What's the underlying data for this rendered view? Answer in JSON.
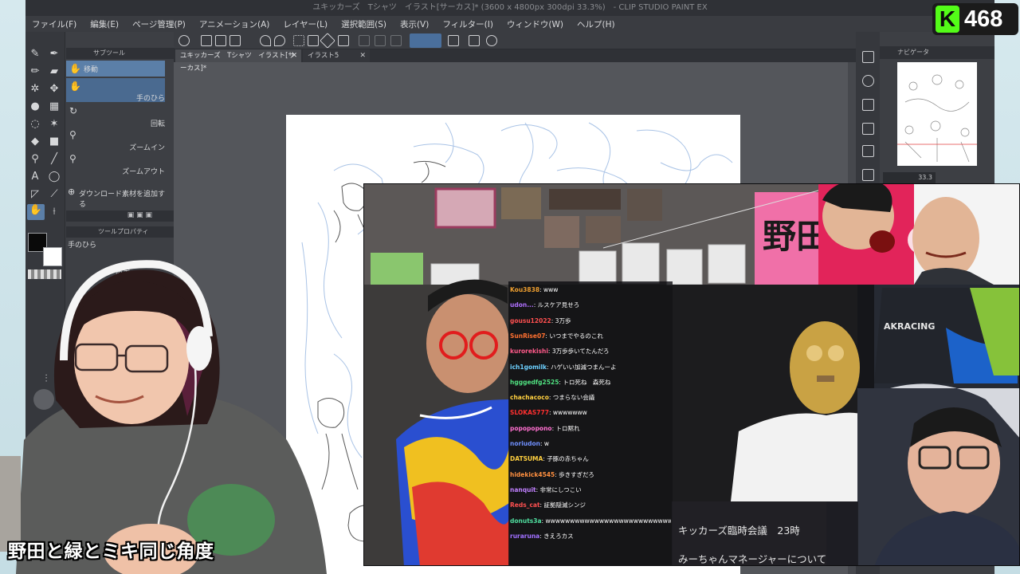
{
  "app": {
    "window_title": "ユキッカーズ　Tシャツ　イラスト[サーカス]* (3600 x 4800px 300dpi 33.3%)　- CLIP STUDIO PAINT EX",
    "menu": [
      "ファイル(F)",
      "編集(E)",
      "ページ管理(P)",
      "アニメーション(A)",
      "レイヤー(L)",
      "選択範囲(S)",
      "表示(V)",
      "フィルター(I)",
      "ウィンドウ(W)",
      "ヘルプ(H)"
    ]
  },
  "subtool": {
    "panel_title": "サブツール",
    "items": [
      {
        "label": "移動",
        "icon": "hand-icon"
      },
      {
        "label": "手のひら",
        "icon": "hand-icon"
      },
      {
        "label": "回転",
        "icon": "rotate-icon"
      },
      {
        "label": "ズームイン",
        "icon": "magnifier-icon"
      },
      {
        "label": "ズームアウト",
        "icon": "magnifier-icon"
      }
    ],
    "add_material": "ダウンロード素材を追加する"
  },
  "tool_property": {
    "panel_title": "ツールプロパティ",
    "tool_name": "手のひら",
    "setting_partial": "設定"
  },
  "documents": {
    "tabs": [
      {
        "label": "ユキッカーズ　Tシャツ　イラスト[サーカス]*"
      },
      {
        "label": "イラスト5"
      }
    ]
  },
  "navigator": {
    "panel_title": "ナビゲータ",
    "zoom": "33.3"
  },
  "chat": [
    {
      "user": "Kou3838",
      "msg": "www",
      "color": "#f0a030"
    },
    {
      "user": "udon...",
      "msg": "ルスケア見せろ",
      "color": "#b070ff"
    },
    {
      "user": "gousu12022",
      "msg": "3万歩",
      "color": "#ff5050"
    },
    {
      "user": "SunRise07",
      "msg": "いつまでやるのこれ",
      "color": "#ff7030"
    },
    {
      "user": "kurorekishi",
      "msg": "3万歩歩いてたんだろ",
      "color": "#ff5a8a"
    },
    {
      "user": "ich1gomilk",
      "msg": "ハゲいい加減つまんーよ",
      "color": "#6cd0ff"
    },
    {
      "user": "hgggedfg2525",
      "msg": "トロ死ね　森死ね",
      "color": "#50e080"
    },
    {
      "user": "chachacoco",
      "msg": "つまらない会議",
      "color": "#ffd040"
    },
    {
      "user": "SLOKAS777",
      "msg": "wwwwwww",
      "color": "#ff3030"
    },
    {
      "user": "popopopono",
      "msg": "トロ黙れ",
      "color": "#ff70d0"
    },
    {
      "user": "noriudon",
      "msg": "w",
      "color": "#7090ff"
    },
    {
      "user": "DATSUMA",
      "msg": "子豚の赤ちゃん",
      "color": "#ffd040"
    },
    {
      "user": "hidekick4545",
      "msg": "歩きすぎだろ",
      "color": "#ff9040"
    },
    {
      "user": "nanquit",
      "msg": "非常にしつこい",
      "color": "#c080ff"
    },
    {
      "user": "Reds_cat",
      "msg": "証拠隠滅シンジ",
      "color": "#ff5050"
    },
    {
      "user": "donuts3a",
      "msg": "wwwwwwwwwwwwwwwwwwwwwwwwwwwwwwwwwwwwwwwwwwwwwwwwwwwwwwwwwww",
      "color": "#50e0a0"
    },
    {
      "user": "ruraruna",
      "msg": "きえろカス",
      "color": "#a070ff"
    }
  ],
  "meeting_info": {
    "line1": "キッカーズ臨時会議　23時",
    "line2": "みーちゃんマネージャーについて"
  },
  "banner_text": "野田",
  "chair_brand": "AKRACING",
  "caption": "野田と緑とミキ同じ角度",
  "viewer_badge": {
    "letter": "K",
    "count": "468",
    "color": "#53fc18"
  }
}
